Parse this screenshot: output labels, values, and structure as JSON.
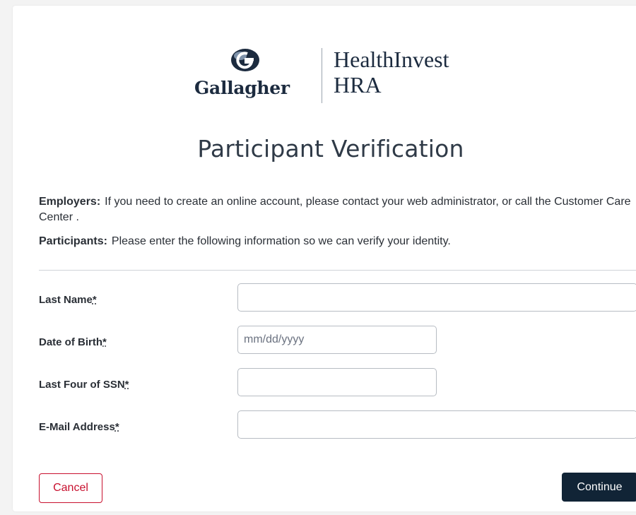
{
  "brand": {
    "wordmark": "Gallagher",
    "product_line1": "HealthInvest",
    "product_line2": "HRA",
    "logo_icon": "globe-logo-icon",
    "navy": "#1c2b3f",
    "accent_red": "#c8102e"
  },
  "page": {
    "title": "Participant Verification"
  },
  "intro": {
    "employers_label": "Employers:",
    "employers_text": "If you need to create an online account, please contact your web administrator, or call the Customer Care Center .",
    "participants_label": "Participants:",
    "participants_text": "Please enter the following information so we can verify your identity."
  },
  "form": {
    "last_name": {
      "label": "Last Name",
      "required_mark": "*",
      "value": ""
    },
    "dob": {
      "label": "Date of Birth",
      "required_mark": "*",
      "value": "",
      "placeholder": "mm/dd/yyyy"
    },
    "ssn_last4": {
      "label": "Last Four of SSN",
      "required_mark": "*",
      "value": ""
    },
    "email": {
      "label": "E-Mail Address",
      "required_mark": "*",
      "value": ""
    }
  },
  "actions": {
    "cancel_label": "Cancel",
    "continue_label": "Continue",
    "continue_color": "#112436"
  }
}
